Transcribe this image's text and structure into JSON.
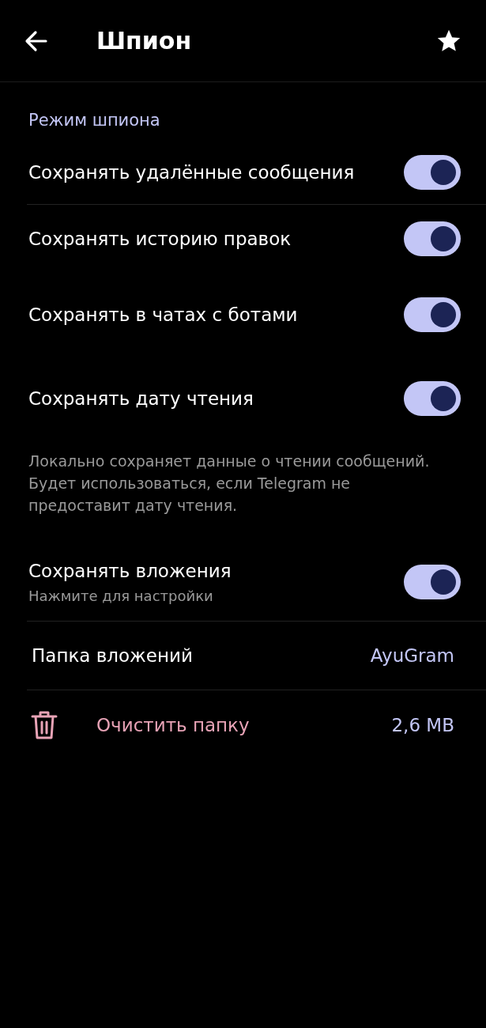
{
  "header": {
    "title": "Шпион"
  },
  "section_title": "Режим шпиона",
  "items": [
    {
      "kind": "toggle",
      "label": "Сохранять удалённые сообщения",
      "on": true,
      "divider": true
    },
    {
      "kind": "toggle",
      "label": "Сохранять историю правок",
      "on": true,
      "divider": false
    },
    {
      "kind": "toggle",
      "label": "Сохранять в чатах с ботами",
      "on": true,
      "divider": false
    },
    {
      "kind": "toggle",
      "label": "Сохранять дату чтения",
      "on": true,
      "divider": false
    },
    {
      "kind": "note",
      "text": "Локально сохраняет данные о чтении сообщений. Будет использоваться, если Telegram не предоставит дату чтения.",
      "divider": false
    },
    {
      "kind": "toggle",
      "label": "Сохранять вложения",
      "subtitle": "Нажмите для настройки",
      "on": true,
      "divider": true
    },
    {
      "kind": "value",
      "label": "Папка вложений",
      "value": "AyuGram",
      "divider": true
    },
    {
      "kind": "danger",
      "label": "Очистить папку",
      "value": "2,6 MB",
      "divider": false
    }
  ]
}
